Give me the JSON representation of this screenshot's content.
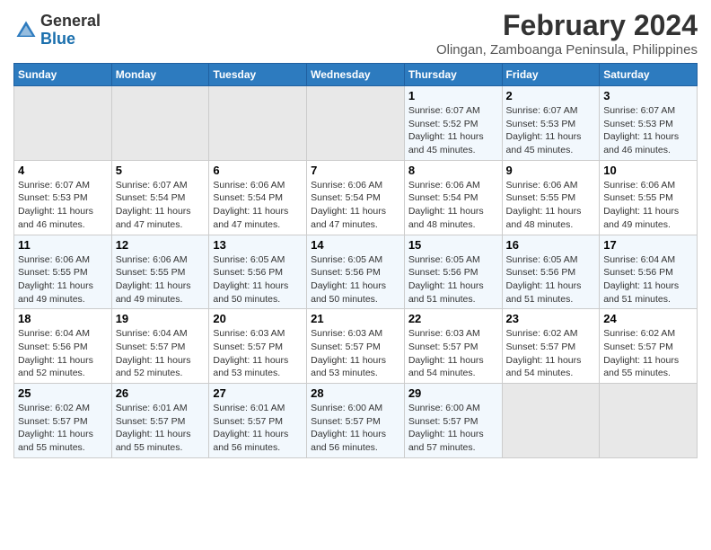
{
  "header": {
    "logo_line1": "General",
    "logo_line2": "Blue",
    "main_title": "February 2024",
    "subtitle": "Olingan, Zamboanga Peninsula, Philippines"
  },
  "columns": [
    "Sunday",
    "Monday",
    "Tuesday",
    "Wednesday",
    "Thursday",
    "Friday",
    "Saturday"
  ],
  "weeks": [
    [
      {
        "day": "",
        "info": ""
      },
      {
        "day": "",
        "info": ""
      },
      {
        "day": "",
        "info": ""
      },
      {
        "day": "",
        "info": ""
      },
      {
        "day": "1",
        "info": "Sunrise: 6:07 AM\nSunset: 5:52 PM\nDaylight: 11 hours\nand 45 minutes."
      },
      {
        "day": "2",
        "info": "Sunrise: 6:07 AM\nSunset: 5:53 PM\nDaylight: 11 hours\nand 45 minutes."
      },
      {
        "day": "3",
        "info": "Sunrise: 6:07 AM\nSunset: 5:53 PM\nDaylight: 11 hours\nand 46 minutes."
      }
    ],
    [
      {
        "day": "4",
        "info": "Sunrise: 6:07 AM\nSunset: 5:53 PM\nDaylight: 11 hours\nand 46 minutes."
      },
      {
        "day": "5",
        "info": "Sunrise: 6:07 AM\nSunset: 5:54 PM\nDaylight: 11 hours\nand 47 minutes."
      },
      {
        "day": "6",
        "info": "Sunrise: 6:06 AM\nSunset: 5:54 PM\nDaylight: 11 hours\nand 47 minutes."
      },
      {
        "day": "7",
        "info": "Sunrise: 6:06 AM\nSunset: 5:54 PM\nDaylight: 11 hours\nand 47 minutes."
      },
      {
        "day": "8",
        "info": "Sunrise: 6:06 AM\nSunset: 5:54 PM\nDaylight: 11 hours\nand 48 minutes."
      },
      {
        "day": "9",
        "info": "Sunrise: 6:06 AM\nSunset: 5:55 PM\nDaylight: 11 hours\nand 48 minutes."
      },
      {
        "day": "10",
        "info": "Sunrise: 6:06 AM\nSunset: 5:55 PM\nDaylight: 11 hours\nand 49 minutes."
      }
    ],
    [
      {
        "day": "11",
        "info": "Sunrise: 6:06 AM\nSunset: 5:55 PM\nDaylight: 11 hours\nand 49 minutes."
      },
      {
        "day": "12",
        "info": "Sunrise: 6:06 AM\nSunset: 5:55 PM\nDaylight: 11 hours\nand 49 minutes."
      },
      {
        "day": "13",
        "info": "Sunrise: 6:05 AM\nSunset: 5:56 PM\nDaylight: 11 hours\nand 50 minutes."
      },
      {
        "day": "14",
        "info": "Sunrise: 6:05 AM\nSunset: 5:56 PM\nDaylight: 11 hours\nand 50 minutes."
      },
      {
        "day": "15",
        "info": "Sunrise: 6:05 AM\nSunset: 5:56 PM\nDaylight: 11 hours\nand 51 minutes."
      },
      {
        "day": "16",
        "info": "Sunrise: 6:05 AM\nSunset: 5:56 PM\nDaylight: 11 hours\nand 51 minutes."
      },
      {
        "day": "17",
        "info": "Sunrise: 6:04 AM\nSunset: 5:56 PM\nDaylight: 11 hours\nand 51 minutes."
      }
    ],
    [
      {
        "day": "18",
        "info": "Sunrise: 6:04 AM\nSunset: 5:56 PM\nDaylight: 11 hours\nand 52 minutes."
      },
      {
        "day": "19",
        "info": "Sunrise: 6:04 AM\nSunset: 5:57 PM\nDaylight: 11 hours\nand 52 minutes."
      },
      {
        "day": "20",
        "info": "Sunrise: 6:03 AM\nSunset: 5:57 PM\nDaylight: 11 hours\nand 53 minutes."
      },
      {
        "day": "21",
        "info": "Sunrise: 6:03 AM\nSunset: 5:57 PM\nDaylight: 11 hours\nand 53 minutes."
      },
      {
        "day": "22",
        "info": "Sunrise: 6:03 AM\nSunset: 5:57 PM\nDaylight: 11 hours\nand 54 minutes."
      },
      {
        "day": "23",
        "info": "Sunrise: 6:02 AM\nSunset: 5:57 PM\nDaylight: 11 hours\nand 54 minutes."
      },
      {
        "day": "24",
        "info": "Sunrise: 6:02 AM\nSunset: 5:57 PM\nDaylight: 11 hours\nand 55 minutes."
      }
    ],
    [
      {
        "day": "25",
        "info": "Sunrise: 6:02 AM\nSunset: 5:57 PM\nDaylight: 11 hours\nand 55 minutes."
      },
      {
        "day": "26",
        "info": "Sunrise: 6:01 AM\nSunset: 5:57 PM\nDaylight: 11 hours\nand 55 minutes."
      },
      {
        "day": "27",
        "info": "Sunrise: 6:01 AM\nSunset: 5:57 PM\nDaylight: 11 hours\nand 56 minutes."
      },
      {
        "day": "28",
        "info": "Sunrise: 6:00 AM\nSunset: 5:57 PM\nDaylight: 11 hours\nand 56 minutes."
      },
      {
        "day": "29",
        "info": "Sunrise: 6:00 AM\nSunset: 5:57 PM\nDaylight: 11 hours\nand 57 minutes."
      },
      {
        "day": "",
        "info": ""
      },
      {
        "day": "",
        "info": ""
      }
    ]
  ]
}
